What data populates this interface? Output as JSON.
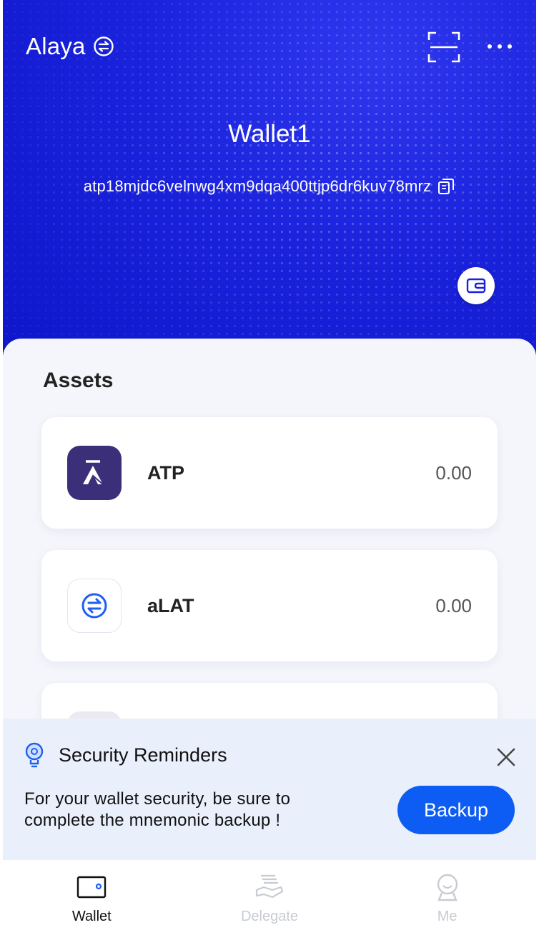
{
  "header": {
    "chain_name": "Alaya",
    "chain_icon": "swap-circle-icon",
    "scan_icon": "scan-icon",
    "more_icon": "more-icon",
    "wallet_name": "Wallet1",
    "address": "atp18mjdc6velnwg4xm9dqa400ttjp6dr6kuv78mrz",
    "copy_icon": "copy-icon",
    "switch_icon": "wallet-icon",
    "accent_color": "#1a22dc"
  },
  "assets": {
    "title": "Assets",
    "items": [
      {
        "name": "ATP",
        "value": "0.00",
        "icon": "atp-logo-icon"
      },
      {
        "name": "aLAT",
        "value": "0.00",
        "icon": "alat-swap-icon"
      }
    ]
  },
  "reminder": {
    "title": "Security Reminders",
    "text": "For your wallet security, be sure to complete the mnemonic backup !",
    "button": "Backup",
    "button_color": "#0d5cf3"
  },
  "tabs": [
    {
      "label": "Wallet",
      "active": true
    },
    {
      "label": "Delegate",
      "active": false
    },
    {
      "label": "Me",
      "active": false
    }
  ]
}
